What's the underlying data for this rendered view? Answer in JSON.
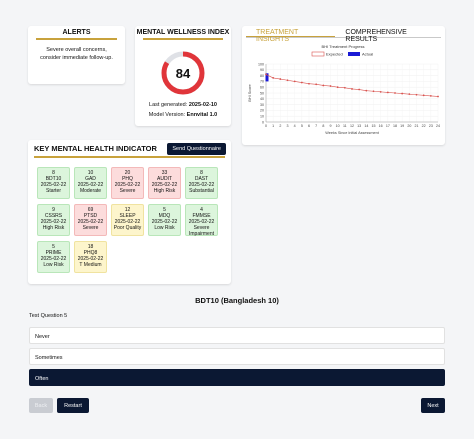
{
  "alerts": {
    "title": "ALERTS",
    "message_line1": "Severe overall concerns,",
    "message_line2": "consider immediate follow-up."
  },
  "wellness": {
    "title": "MENTAL WELLNESS INDEX",
    "score": "84",
    "score_value": 84,
    "score_max": 100,
    "generated_label": "Last generated:",
    "generated_date": "2025-02-10",
    "model_label": "Model Version:",
    "model_version": "Ennvital 1.0",
    "colors": {
      "ring": "#e0353a",
      "track": "#dfe1e6"
    }
  },
  "treatment": {
    "tab_insights": "TREATMENT INSIGHTS",
    "tab_comprehensive": "COMPREHENSIVE RESULTS"
  },
  "chart_data": {
    "type": "line",
    "title": "BHI Treatment Progress",
    "xlabel": "Weeks Since Initial Assessment",
    "ylabel": "BHI Score",
    "ylim": [
      0,
      100
    ],
    "yticks": [
      0,
      10,
      20,
      30,
      40,
      50,
      60,
      70,
      80,
      90,
      100
    ],
    "xticks": [
      0,
      1,
      2,
      3,
      4,
      5,
      6,
      7,
      8,
      9,
      10,
      11,
      12,
      13,
      14,
      15,
      16,
      17,
      18,
      19,
      20,
      21,
      22,
      23,
      24
    ],
    "legend": [
      "Expected",
      "Actual"
    ],
    "legend_position": "top-center",
    "series": [
      {
        "name": "Expected",
        "color": "#d9534f",
        "x": [
          0,
          1,
          2,
          3,
          4,
          5,
          6,
          7,
          8,
          9,
          10,
          11,
          12,
          13,
          14,
          15,
          16,
          17,
          18,
          19,
          20,
          21,
          22,
          23,
          24
        ],
        "values": [
          82,
          76,
          74,
          72,
          70,
          68,
          66,
          65,
          63,
          62,
          60,
          59,
          57,
          56,
          54,
          53,
          52,
          51,
          50,
          49,
          48,
          47,
          46,
          45,
          44
        ]
      },
      {
        "name": "Actual",
        "color": "#1a1ad6",
        "type": "bar",
        "x": [
          0
        ],
        "values": [
          84
        ]
      }
    ]
  },
  "indicators": {
    "title": "KEY MENTAL HEALTH INDICATOR",
    "send_button": "Send Questionnaire",
    "tiles": [
      {
        "score": "8",
        "name": "BDT10",
        "date": "2025-02-22",
        "status": "Starter",
        "tone": "green"
      },
      {
        "score": "10",
        "name": "GAD",
        "date": "2025-02-22",
        "status": "Moderate",
        "tone": "green"
      },
      {
        "score": "20",
        "name": "PHQ",
        "date": "2025-02-22",
        "status": "Severe",
        "tone": "red"
      },
      {
        "score": "33",
        "name": "AUDIT",
        "date": "2025-02-22",
        "status": "High Risk",
        "tone": "red"
      },
      {
        "score": "8",
        "name": "DAST",
        "date": "2025-02-22",
        "status": "Substantial",
        "tone": "green"
      },
      {
        "score": "9",
        "name": "CSSRS",
        "date": "2025-02-22",
        "status": "High Risk",
        "tone": "green"
      },
      {
        "score": "69",
        "name": "PTSD",
        "date": "2025-02-22",
        "status": "Severe",
        "tone": "red"
      },
      {
        "score": "12",
        "name": "SLEEP",
        "date": "2025-02-22",
        "status": "Poor Quality",
        "tone": "yellow"
      },
      {
        "score": "5",
        "name": "MDQ",
        "date": "2025-02-22",
        "status": "Low Risk",
        "tone": "green"
      },
      {
        "score": "4",
        "name": "FMMSE",
        "date": "2025-02-22",
        "status": "Severe Impairment",
        "tone": "green"
      },
      {
        "score": "5",
        "name": "PRIME",
        "date": "2025-02-22",
        "status": "Low Risk",
        "tone": "green"
      },
      {
        "score": "18",
        "name": "PHQ8",
        "date": "2025-02-22",
        "status": "T Medium",
        "tone": "yellow"
      }
    ]
  },
  "questionnaire": {
    "title": "BDT10 (Bangladesh 10)",
    "question": "Test Question 5",
    "options": [
      "Never",
      "Sometimes",
      "Often"
    ],
    "selected_index": 2,
    "back_label": "Back",
    "restart_label": "Restart",
    "next_label": "Next"
  }
}
